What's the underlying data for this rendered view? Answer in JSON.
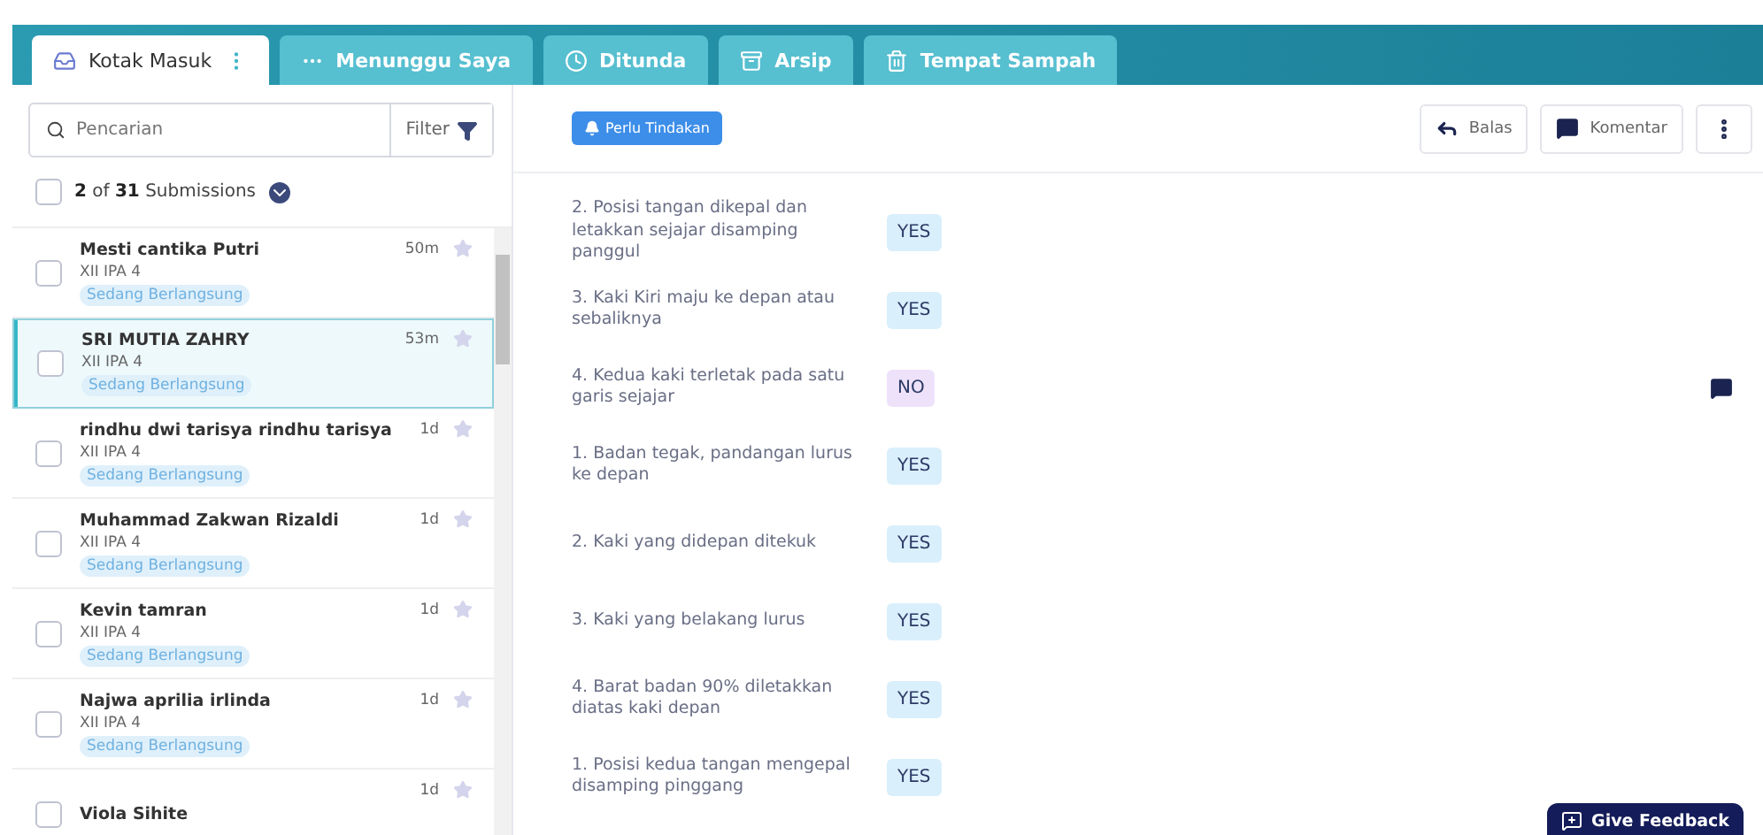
{
  "tabs": [
    {
      "label": "Kotak Masuk",
      "selected": true
    },
    {
      "label": "Menunggu Saya",
      "selected": false
    },
    {
      "label": "Ditunda",
      "selected": false
    },
    {
      "label": "Arsip",
      "selected": false
    },
    {
      "label": "Tempat Sampah",
      "selected": false
    }
  ],
  "search": {
    "placeholder": "Pencarian",
    "filter_label": "Filter"
  },
  "select_all_checked": false,
  "submission_count": "**2** of **31** Submissions",
  "submissions": [
    {
      "name": "Mesti cantika Putri",
      "class": "XII IPA 4",
      "status": "Sedang Berlangsung",
      "time": "50m",
      "selected": false,
      "checked": false
    },
    {
      "name": "SRI MUTIA ZAHRY",
      "class": "XII IPA 4",
      "status": "Sedang Berlangsung",
      "time": "53m",
      "selected": true,
      "checked": false
    },
    {
      "name": "rindhu dwi tarisya rindhu tarisya",
      "class": "XII IPA 4",
      "status": "Sedang Berlangsung",
      "time": "1d",
      "selected": false,
      "checked": false
    },
    {
      "name": "Muhammad Zakwan Rizaldi",
      "class": "XII IPA 4",
      "status": "Sedang Berlangsung",
      "time": "1d",
      "selected": false,
      "checked": false
    },
    {
      "name": "Kevin tamran",
      "class": "XII IPA 4",
      "status": "Sedang Berlangsung",
      "time": "1d",
      "selected": false,
      "checked": false
    },
    {
      "name": "Najwa aprilia irlinda",
      "class": "XII IPA 4",
      "status": "Sedang Berlangsung",
      "time": "1d",
      "selected": false,
      "checked": false
    },
    {
      "name": "Viola Sihite",
      "time": "1d",
      "selected": false,
      "checked": false
    }
  ],
  "action_badge": "Perlu Tindakan",
  "toolbar": {
    "reply": "Balas",
    "comment": "Komentar"
  },
  "answers": [
    {
      "question": "2. Posisi tangan dikepal dan letakkan sejajar disamping panggul",
      "answer": "YES",
      "kind": "yes"
    },
    {
      "question": "3. Kaki Kiri maju ke depan atau sebaliknya",
      "answer": "YES",
      "kind": "yes"
    },
    {
      "question": "4. Kedua kaki terletak pada satu garis sejajar",
      "answer": "NO",
      "kind": "no",
      "commented": true
    },
    {
      "question": "1. Badan tegak, pandangan lurus ke depan",
      "answer": "YES",
      "kind": "yes"
    },
    {
      "question": "2. Kaki yang didepan ditekuk",
      "answer": "YES",
      "kind": "yes"
    },
    {
      "question": "3. Kaki yang belakang lurus",
      "answer": "YES",
      "kind": "yes"
    },
    {
      "question": "4. Barat badan 90% diletakkan diatas kaki depan",
      "answer": "YES",
      "kind": "yes"
    },
    {
      "question": "1. Posisi kedua tangan mengepal disamping pinggang",
      "answer": "YES",
      "kind": "yes"
    }
  ],
  "feedback_button": "Give Feedback"
}
